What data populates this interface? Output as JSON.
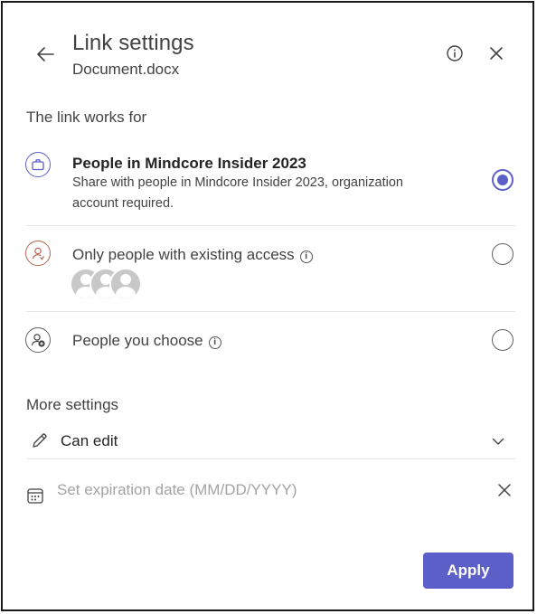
{
  "header": {
    "title": "Link settings",
    "file_name": "Document.docx",
    "back_icon": "arrow-left-icon",
    "info_icon": "info-icon",
    "close_icon": "close-icon"
  },
  "link_works_for": {
    "heading": "The link works for",
    "options": [
      {
        "title": "People in Mindcore Insider 2023",
        "description": "Share with people in Mindcore Insider 2023, organization account required.",
        "icon": "briefcase-icon",
        "selected": true
      },
      {
        "title": "Only people with existing access",
        "icon": "person-sync-icon",
        "selected": false
      },
      {
        "title": "People you choose",
        "icon": "person-add-icon",
        "selected": false
      }
    ]
  },
  "more_settings": {
    "heading": "More settings",
    "permission": "Can edit",
    "expiration_placeholder": "Set expiration date (MM/DD/YYYY)"
  },
  "footer": {
    "apply_label": "Apply"
  },
  "colors": {
    "accent": "#5b5fc7",
    "text": "#242424",
    "muted": "#424242",
    "placeholder": "#a3a3a3"
  }
}
